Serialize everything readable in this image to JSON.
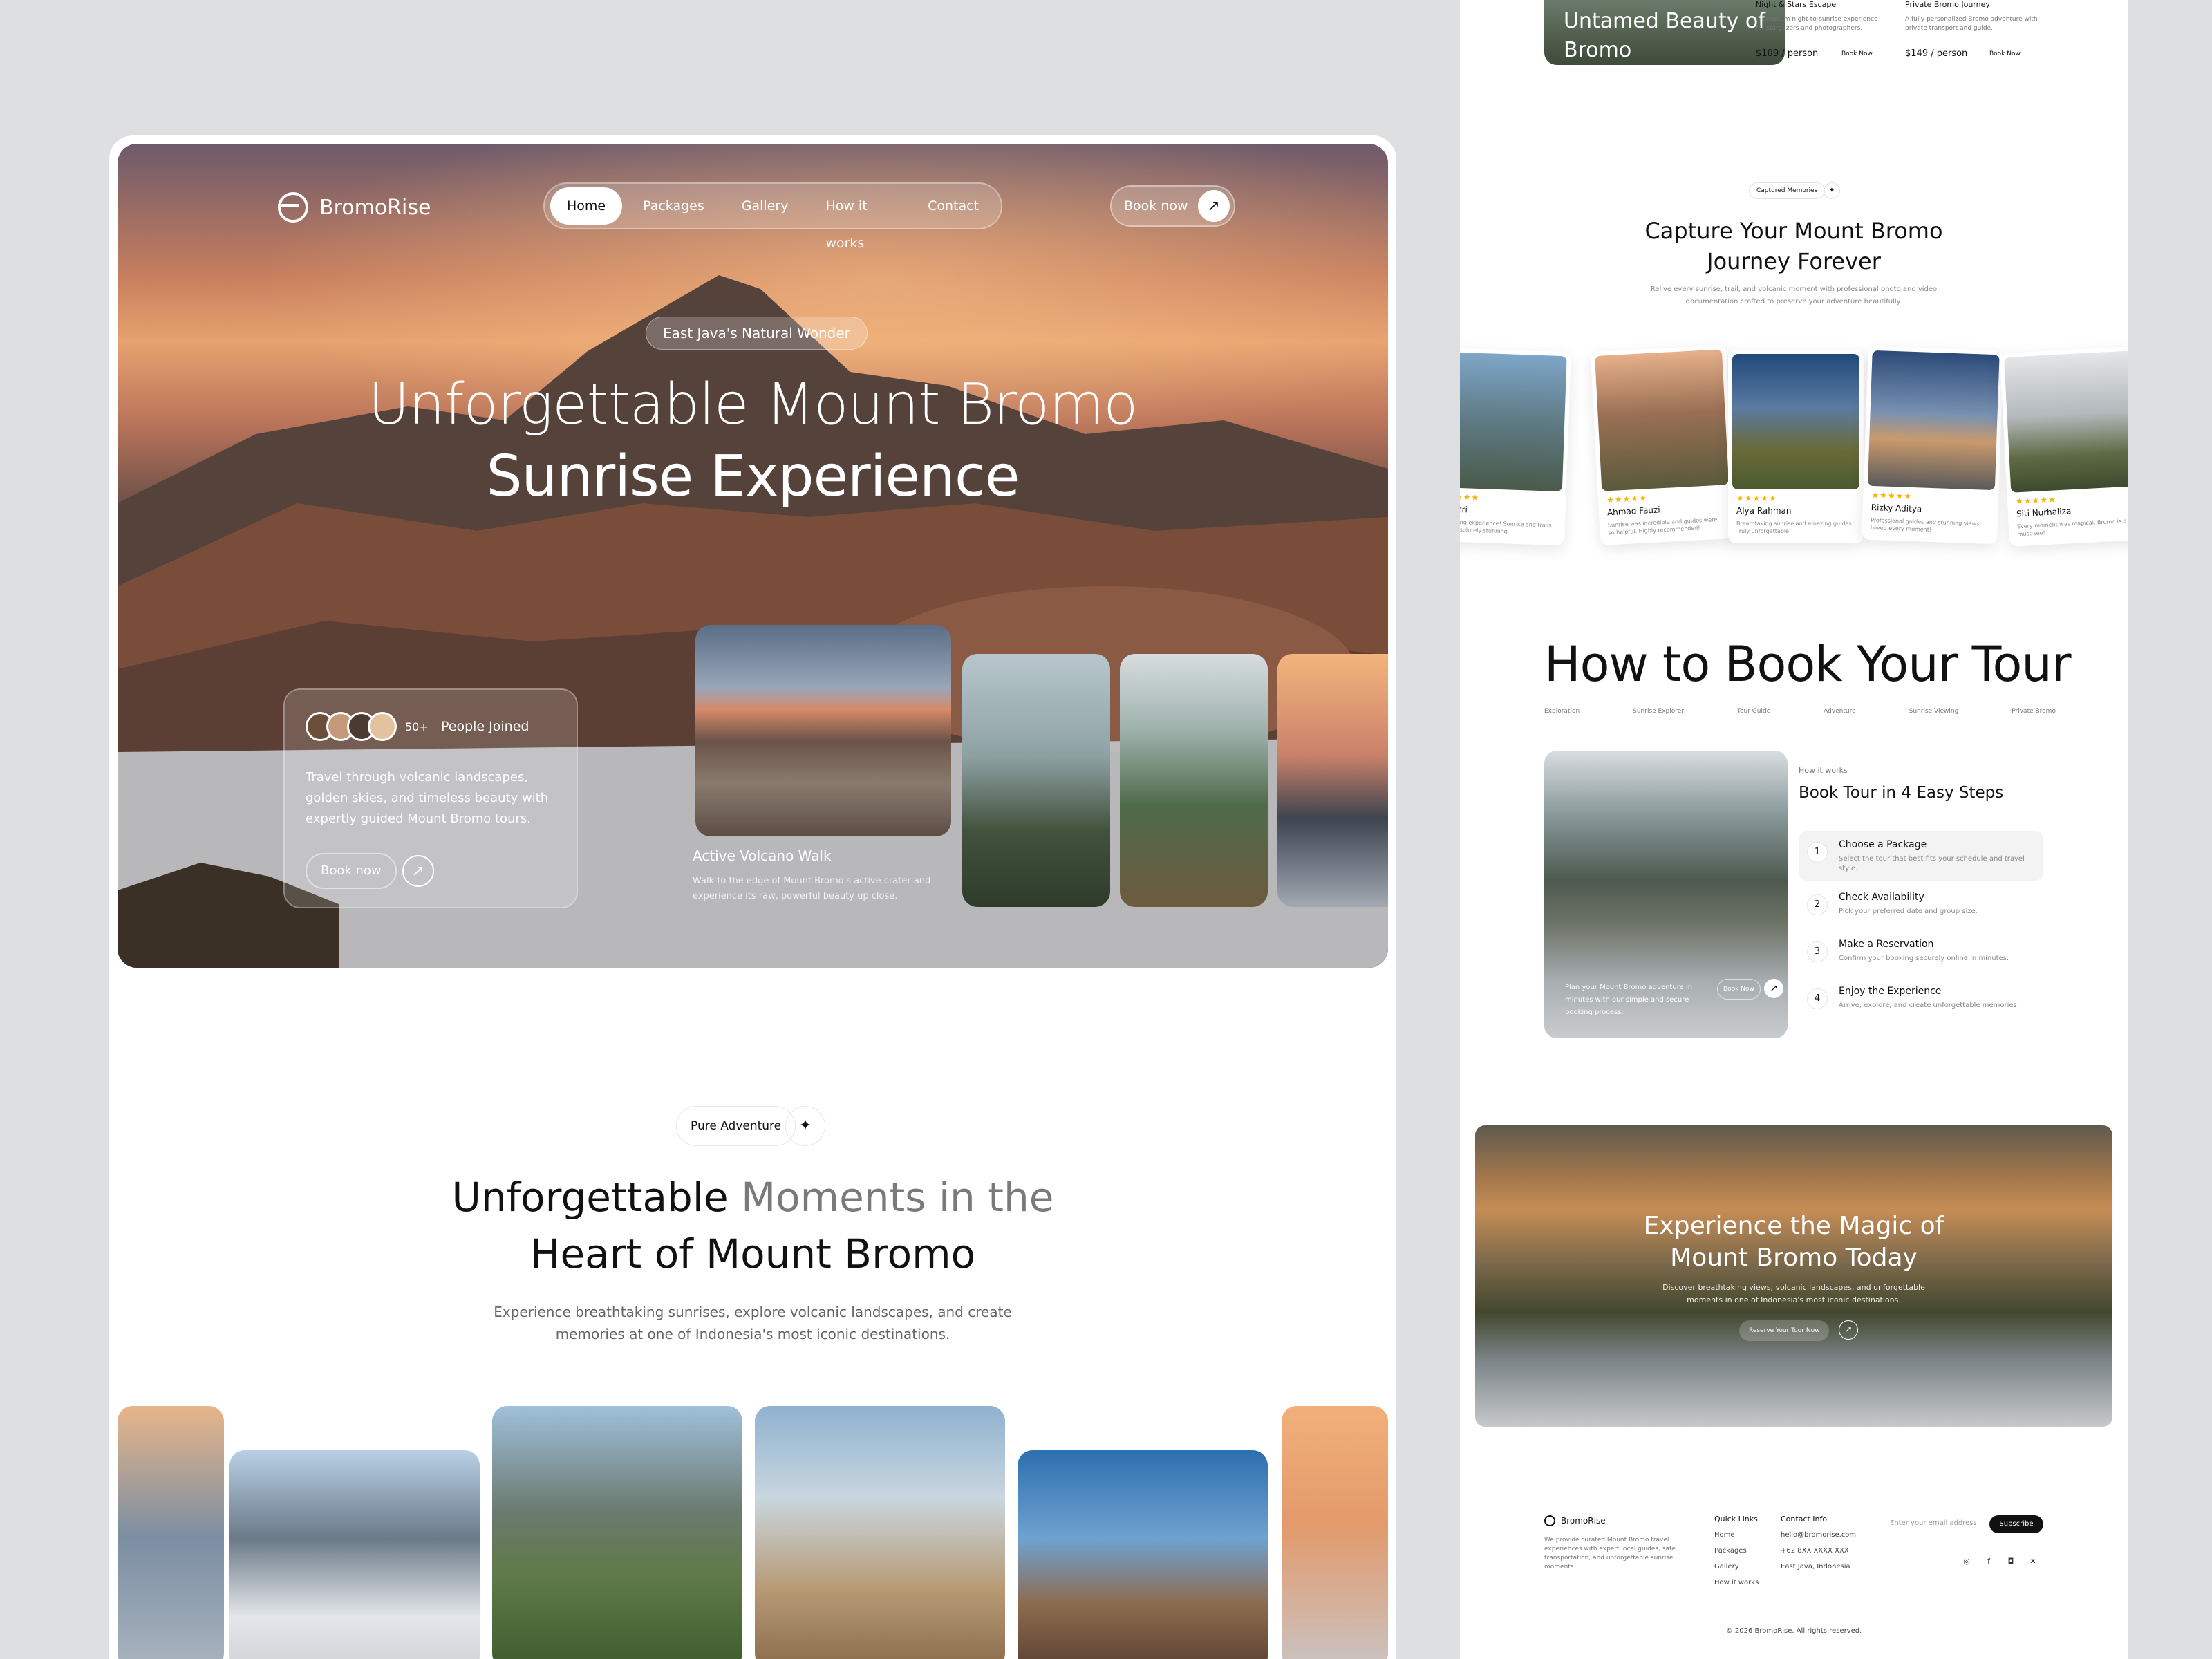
{
  "hero": {
    "brand": "BromoRise",
    "nav": [
      "Home",
      "Packages",
      "Gallery",
      "How it works",
      "Contact"
    ],
    "book_now": "Book now",
    "eyebrow": "East Java's Natural Wonder",
    "title_line1": "Unforgettable Mount Bromo",
    "title_line2": "Sunrise Experience",
    "joined_count": "50+",
    "joined_label": "People Joined",
    "joined_desc": "Travel through volcanic landscapes, golden skies, and timeless beauty with expertly guided Mount Bromo tours.",
    "joined_btn": "Book now",
    "feature_title": "Active Volcano Walk",
    "feature_desc": "Walk to the edge of Mount Bromo's active crater and experience its raw, powerful beauty up close."
  },
  "moments": {
    "pill": "Pure Adventure",
    "title_a": "Unforgettable ",
    "title_b": "Moments in the",
    "title_line2": "Heart of Mount Bromo",
    "sub_line1": "Experience breathtaking sunrises, explore volcanic landscapes, and create",
    "sub_line2": "memories at one of Indonesia's most iconic destinations."
  },
  "right": {
    "packages": {
      "prev_title": "Untamed Beauty of Bromo",
      "items": [
        {
          "name": "Night & Stars Escape",
          "desc": "A premium night-to-sunrise experience for stargazers and photographers.",
          "price": "$109 / person",
          "btn": "Book Now"
        },
        {
          "name": "Private Bromo Journey",
          "desc": "A fully personalized Bromo adventure with private transport and guide.",
          "price": "$149 / person",
          "btn": "Book Now"
        }
      ]
    },
    "capture": {
      "pill": "Captured Memories",
      "title_line1": "Capture Your Mount Bromo",
      "title_line2": "Journey Forever",
      "sub_line1": "Relive every sunrise, trail, and volcanic moment with professional photo and video",
      "sub_line2": "documentation crafted to preserve your adventure beautifully.",
      "cards": [
        {
          "name": "ia Putri",
          "text": "n amazing experience! Sunrise and trails were absolutely stunning."
        },
        {
          "name": "Ahmad Fauzi",
          "text": "Sunrise was incredible and guides were so helpful. Highly recommended!"
        },
        {
          "name": "Alya Rahman",
          "text": "Breathtaking sunrise and amazing guides. Truly unforgettable!"
        },
        {
          "name": "Rizky Aditya",
          "text": "Professional guides and stunning views. Loved every moment!"
        },
        {
          "name": "Siti Nurhaliza",
          "text": "Every moment was magical. Bromo is a must-see!"
        }
      ]
    },
    "howto": {
      "title": "How to Book Your Tour",
      "tags": [
        "Exploration",
        "Sunrise Explorer",
        "Tour Guide",
        "Adventure",
        "Sunrise Viewing",
        "Private Bromo"
      ],
      "img_desc": "Plan your Mount Bromo adventure in minutes with our simple and secure booking process.",
      "img_btn": "Book Now",
      "kicker": "How it works",
      "heading": "Book Tour in 4 Easy Steps",
      "steps": [
        {
          "n": "1",
          "t": "Choose a Package",
          "d": "Select the tour that best fits your schedule and travel style."
        },
        {
          "n": "2",
          "t": "Check Availability",
          "d": "Pick your preferred date and group size."
        },
        {
          "n": "3",
          "t": "Make a Reservation",
          "d": "Confirm your booking securely online in minutes."
        },
        {
          "n": "4",
          "t": "Enjoy the Experience",
          "d": "Arrive, explore, and create unforgettable memories."
        }
      ]
    },
    "cta": {
      "title_line1": "Experience the Magic of",
      "title_line2": "Mount Bromo Today",
      "sub_line1": "Discover breathtaking views, volcanic landscapes, and unforgettable",
      "sub_line2": "moments in one of Indonesia's most iconic destinations.",
      "btn": "Reserve Your Tour Now"
    },
    "footer": {
      "brand": "BromoRise",
      "about": "We provide curated Mount Bromo travel experiences with expert local guides, safe transportation, and unforgettable sunrise moments.",
      "quick_title": "Quick Links",
      "quick": [
        "Home",
        "Packages",
        "Gallery",
        "How it works"
      ],
      "contact_title": "Contact Info",
      "contact": [
        "hello@bromorise.com",
        "+62 8XX XXXX XXX",
        "East Java, Indonesia"
      ],
      "email_placeholder": "Enter your email address",
      "subscribe": "Subscribe",
      "copyright": "© 2026 BromoRise. All rights reserved."
    }
  },
  "colors": {
    "accent": "#111111",
    "star": "#f5b400"
  }
}
